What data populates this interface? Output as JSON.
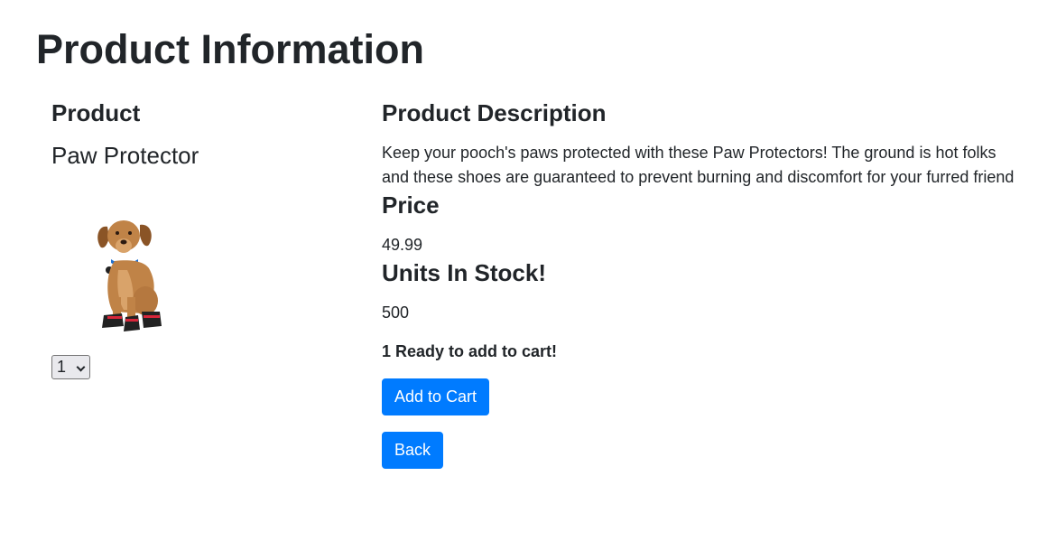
{
  "page": {
    "title": "Product Information"
  },
  "product": {
    "heading": "Product",
    "name": "Paw Protector",
    "image_icon": "dog-wearing-shoes-image",
    "quantity": {
      "selected": "1"
    }
  },
  "details": {
    "description_heading": "Product Description",
    "description": "Keep your pooch's paws protected with these Paw Protectors! The ground is hot folks and these shoes are guaranteed to prevent burning and discomfort for your furred friend",
    "price_heading": "Price",
    "price": "49.99",
    "stock_heading": "Units In Stock!",
    "stock": "500",
    "ready_message": "1 Ready to add to cart!"
  },
  "actions": {
    "add_to_cart_label": "Add to Cart",
    "back_label": "Back"
  },
  "colors": {
    "primary": "#007bff",
    "text": "#212529"
  }
}
